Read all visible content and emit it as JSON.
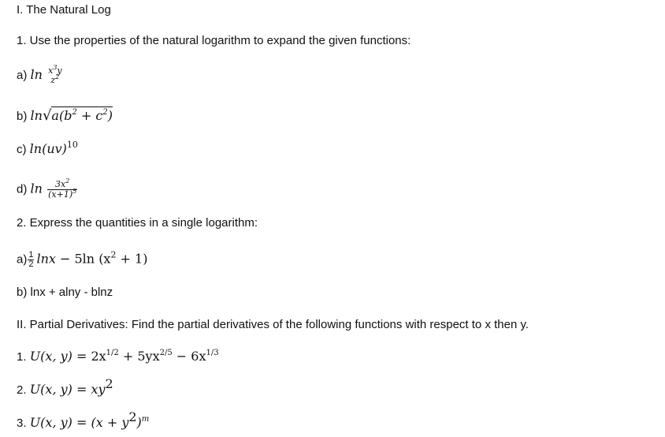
{
  "section1": {
    "heading": "I. The Natural Log",
    "q1": {
      "prompt": "1. Use the properties of the natural logarithm to expand the given functions:",
      "items": [
        {
          "label": "a)",
          "fn": "ln",
          "num_base": "x",
          "num_exp": "3",
          "num_tail": "y",
          "den_base": "z",
          "den_exp": "2"
        },
        {
          "label": "b)",
          "fn": "ln",
          "radicand_pre": "a(b",
          "exp1": "2",
          "mid": " + c",
          "exp2": "2",
          "post": ")"
        },
        {
          "label": "c)",
          "fn": "ln",
          "arg": "(uv)",
          "exp": "10"
        },
        {
          "label": "d)",
          "fn": "ln",
          "num_pre": "3x",
          "num_exp": "2",
          "den_pre": "(x+1)",
          "den_exp": "5"
        }
      ]
    },
    "q2": {
      "prompt": "2. Express the quantities in a single logarithm:",
      "items": [
        {
          "label": "a)",
          "frac_num": "1",
          "frac_den": "2",
          "term1": "lnx",
          "op": " − 5ln (x",
          "exp": "2",
          "tail": " + 1)"
        },
        {
          "label": "b)",
          "text": "lnx + alny - blnz"
        }
      ]
    }
  },
  "section2": {
    "heading": "II. Partial Derivatives: Find the partial derivatives of the following functions with respect to x then y.",
    "items": [
      {
        "label": "1.",
        "lhs": "U(x, y) = ",
        "t1": "2x",
        "e1": "1/2",
        "t2": " + 5yx",
        "e2": "2/5",
        "t3": " − 6x",
        "e3": "1/3"
      },
      {
        "label": "2.",
        "lhs": "U(x, y) = ",
        "t1": "xy",
        "e1": "2"
      },
      {
        "label": "3.",
        "lhs": "U(x, y) = ",
        "t1": "(x + y",
        "e1": "2",
        "t2": ")",
        "e2": "m"
      }
    ]
  }
}
